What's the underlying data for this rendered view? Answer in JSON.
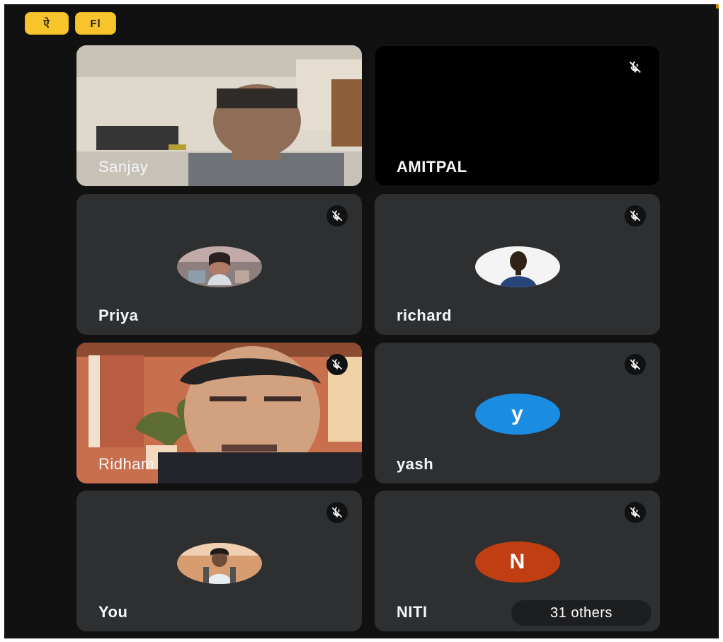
{
  "top_controls": {
    "left_icon": "caption-icon",
    "left_label": "ऐ",
    "right_icon": "layout-icon",
    "right_label": "Fl"
  },
  "participants": [
    {
      "name": "Sanjay",
      "muted": false,
      "mode": "video"
    },
    {
      "name": "AMITPAL",
      "muted": true,
      "mode": "blank"
    },
    {
      "name": "Priya",
      "muted": true,
      "mode": "photo"
    },
    {
      "name": "richard",
      "muted": true,
      "mode": "photo"
    },
    {
      "name": "Ridham",
      "muted": true,
      "mode": "video"
    },
    {
      "name": "yash",
      "muted": true,
      "mode": "letter",
      "letter": "y",
      "accent": "#1a8ce2"
    },
    {
      "name": "You",
      "muted": true,
      "mode": "photo"
    },
    {
      "name": "NITI",
      "muted": true,
      "mode": "letter",
      "letter": "N",
      "accent": "#c13e12"
    }
  ],
  "others_badge": "31 others"
}
